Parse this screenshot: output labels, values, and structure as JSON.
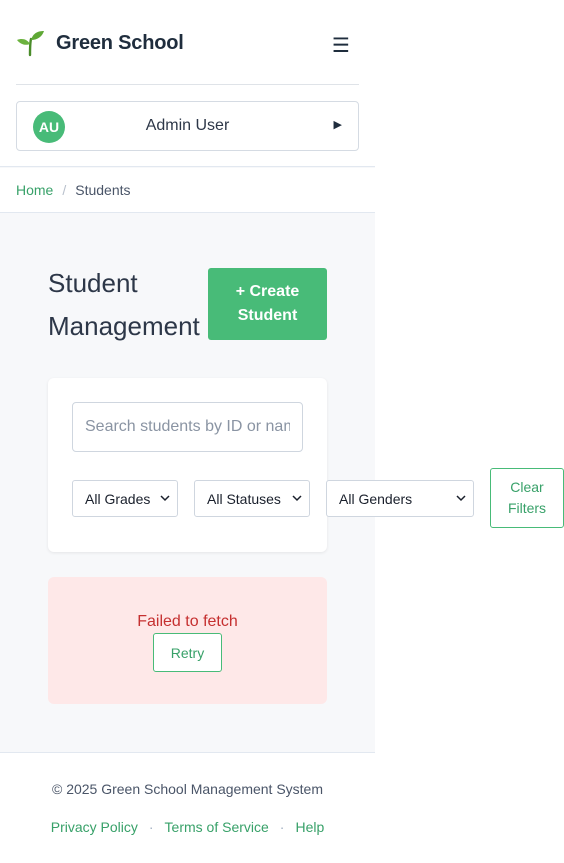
{
  "brand": {
    "name": "Green School",
    "logo_icon": "sprout-icon",
    "accent": "#48bb78"
  },
  "header": {
    "menu_icon": "☰"
  },
  "user": {
    "initials": "AU",
    "name": "Admin User",
    "expand_icon": "▶"
  },
  "breadcrumb": {
    "home": "Home",
    "separator": "/",
    "current": "Students"
  },
  "page": {
    "title": "Student Management",
    "create_label": "+ Create Student"
  },
  "filters": {
    "search_placeholder": "Search students by ID or name",
    "search_value": "",
    "grades": "All Grades",
    "statuses": "All Statuses",
    "genders": "All Genders",
    "clear_label": "Clear Filters"
  },
  "error": {
    "message": "Failed to fetch",
    "retry_label": "Retry",
    "color": "#c53030"
  },
  "footer": {
    "copyright": "© 2025 Green School Management System",
    "links": [
      "Privacy Policy",
      "Terms of Service",
      "Help"
    ],
    "separator": "·"
  }
}
